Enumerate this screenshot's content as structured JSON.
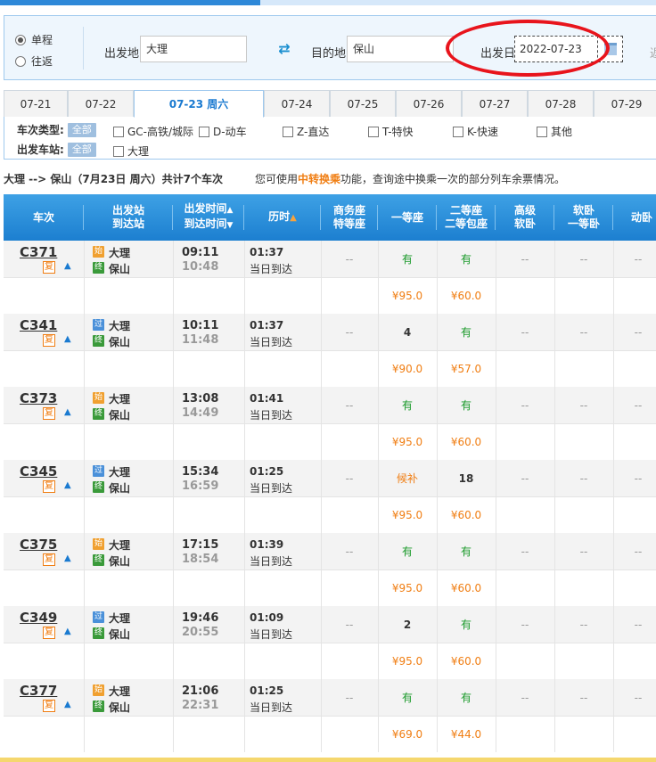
{
  "query": {
    "oneway_label": "单程",
    "roundtrip_label": "往返",
    "from_label": "出发地",
    "from_value": "大理",
    "to_label": "目的地",
    "to_value": "保山",
    "date_label": "出发日",
    "date_value": "2022-07-23",
    "edge_label": "返"
  },
  "tabs": [
    "07-21",
    "07-22",
    "07-23 周六",
    "07-24",
    "07-25",
    "07-26",
    "07-27",
    "07-28",
    "07-29"
  ],
  "filters": {
    "type_label": "车次类型:",
    "station_label": "出发车站:",
    "all_label": "全部",
    "types": [
      "GC-高铁/城际",
      "D-动车",
      "Z-直达",
      "T-特快",
      "K-快速",
      "其他"
    ],
    "stations": [
      "大理"
    ]
  },
  "summary": {
    "route": "大理 --> 保山（7月23日 周六）共计",
    "count": "7",
    "suffix": "个车次",
    "note_pre": "您可使用",
    "note_hl": "中转换乘",
    "note_post": "功能，查询途中换乘一次的部分列车余票情况。"
  },
  "headers": {
    "train": "车次",
    "station1": "出发站",
    "station2": "到达站",
    "time1": "出发时间",
    "time2": "到达时间",
    "duration": "历时",
    "biz1": "商务座",
    "biz2": "特等座",
    "first": "一等座",
    "second1": "二等座",
    "second2": "二等包座",
    "hsl1": "高级",
    "hsl2": "软卧",
    "sl1": "软卧",
    "sl2": "一等卧",
    "dw": "动卧"
  },
  "fu_label": "复",
  "day_arrive": "当日到达",
  "ico_start": "始",
  "ico_pass": "过",
  "ico_end": "终",
  "trains": [
    {
      "no": "C371",
      "from_type": "始",
      "from": "大理",
      "to": "保山",
      "dep": "09:11",
      "arr": "10:48",
      "dur": "01:37",
      "biz": "--",
      "first": "有",
      "second": "有",
      "hsl": "--",
      "sl": "--",
      "dw": "--",
      "p_first": "¥95.0",
      "p_second": "¥60.0"
    },
    {
      "no": "C341",
      "from_type": "过",
      "from": "大理",
      "to": "保山",
      "dep": "10:11",
      "arr": "11:48",
      "dur": "01:37",
      "biz": "--",
      "first": "4",
      "second": "有",
      "hsl": "--",
      "sl": "--",
      "dw": "--",
      "p_first": "¥90.0",
      "p_second": "¥57.0"
    },
    {
      "no": "C373",
      "from_type": "始",
      "from": "大理",
      "to": "保山",
      "dep": "13:08",
      "arr": "14:49",
      "dur": "01:41",
      "biz": "--",
      "first": "有",
      "second": "有",
      "hsl": "--",
      "sl": "--",
      "dw": "--",
      "p_first": "¥95.0",
      "p_second": "¥60.0"
    },
    {
      "no": "C345",
      "from_type": "过",
      "from": "大理",
      "to": "保山",
      "dep": "15:34",
      "arr": "16:59",
      "dur": "01:25",
      "biz": "--",
      "first": "候补",
      "second": "18",
      "hsl": "--",
      "sl": "--",
      "dw": "--",
      "p_first": "¥95.0",
      "p_second": "¥60.0"
    },
    {
      "no": "C375",
      "from_type": "始",
      "from": "大理",
      "to": "保山",
      "dep": "17:15",
      "arr": "18:54",
      "dur": "01:39",
      "biz": "--",
      "first": "有",
      "second": "有",
      "hsl": "--",
      "sl": "--",
      "dw": "--",
      "p_first": "¥95.0",
      "p_second": "¥60.0"
    },
    {
      "no": "C349",
      "from_type": "过",
      "from": "大理",
      "to": "保山",
      "dep": "19:46",
      "arr": "20:55",
      "dur": "01:09",
      "biz": "--",
      "first": "2",
      "second": "有",
      "hsl": "--",
      "sl": "--",
      "dw": "--",
      "p_first": "¥95.0",
      "p_second": "¥60.0"
    },
    {
      "no": "C377",
      "from_type": "始",
      "from": "大理",
      "to": "保山",
      "dep": "21:06",
      "arr": "22:31",
      "dur": "01:25",
      "biz": "--",
      "first": "有",
      "second": "有",
      "hsl": "--",
      "sl": "--",
      "dw": "--",
      "p_first": "¥69.0",
      "p_second": "¥44.0"
    }
  ],
  "colors": {
    "accent": "#1a7ad0",
    "orange": "#f07e13",
    "green": "#1a9a2a",
    "highlight_ring": "#e8141c"
  }
}
